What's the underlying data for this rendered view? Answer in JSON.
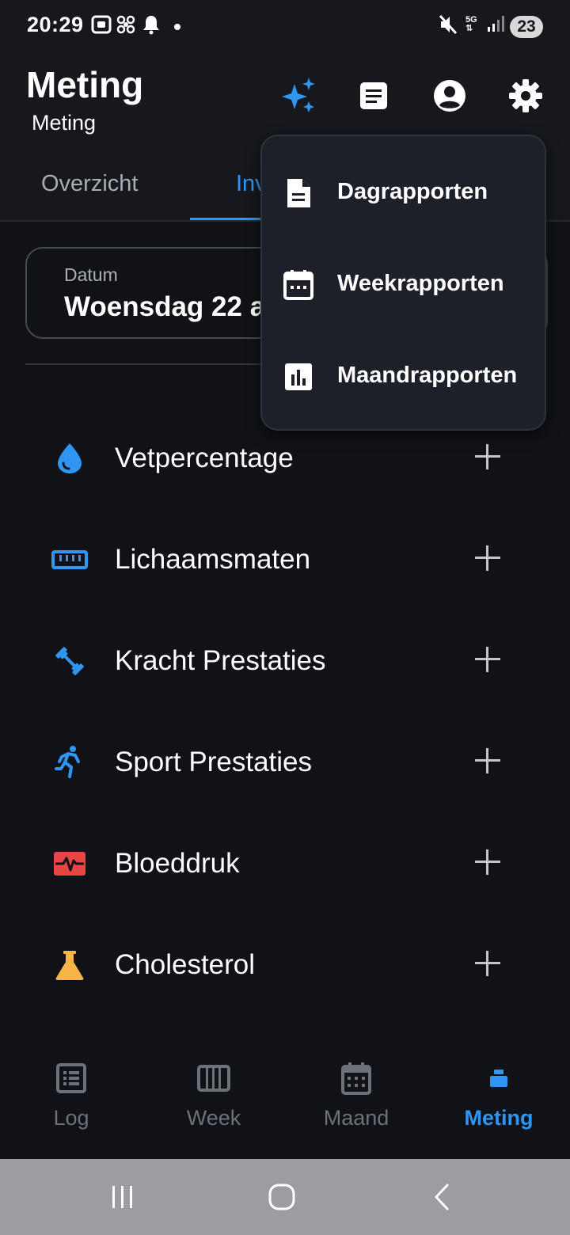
{
  "status_bar": {
    "time": "20:29",
    "network": "5G",
    "battery": "23",
    "icons": [
      "screenshot-icon",
      "fan-icon",
      "bell-icon",
      "mute-icon",
      "signal-icon"
    ]
  },
  "app_bar": {
    "title": "Meting",
    "subtitle": "Meting",
    "actions": [
      "sparkle-icon",
      "notes-icon",
      "account-icon",
      "settings-icon"
    ]
  },
  "tabs": [
    {
      "label": "Overzicht",
      "active": false
    },
    {
      "label": "Inv",
      "active": true
    }
  ],
  "date_field": {
    "label": "Datum",
    "value": "Woensdag 22 a"
  },
  "measurements": [
    {
      "label": "Vetpercentage",
      "icon": "water-drop-icon",
      "color": "#2f96f3"
    },
    {
      "label": "Lichaamsmaten",
      "icon": "ruler-icon",
      "color": "#2f96f3"
    },
    {
      "label": "Kracht Prestaties",
      "icon": "dumbbell-icon",
      "color": "#2f96f3"
    },
    {
      "label": "Sport Prestaties",
      "icon": "running-icon",
      "color": "#2f96f3"
    },
    {
      "label": "Bloeddruk",
      "icon": "heart-monitor-icon",
      "color": "#e84545"
    },
    {
      "label": "Cholesterol",
      "icon": "flask-icon",
      "color": "#f7b547"
    }
  ],
  "menu": {
    "items": [
      {
        "label": "Dagrapporten",
        "icon": "document-icon"
      },
      {
        "label": "Weekrapporten",
        "icon": "calendar-week-icon"
      },
      {
        "label": "Maandrapporten",
        "icon": "bar-chart-icon"
      }
    ]
  },
  "bottom_nav": [
    {
      "label": "Log",
      "icon": "list-icon",
      "active": false
    },
    {
      "label": "Week",
      "icon": "week-grid-icon",
      "active": false
    },
    {
      "label": "Maand",
      "icon": "calendar-month-icon",
      "active": false
    },
    {
      "label": "Meting",
      "icon": "scale-icon",
      "active": true
    }
  ],
  "colors": {
    "accent": "#2f96f3",
    "background": "#101217",
    "surface": "#16181d",
    "menu": "#1d2028"
  }
}
